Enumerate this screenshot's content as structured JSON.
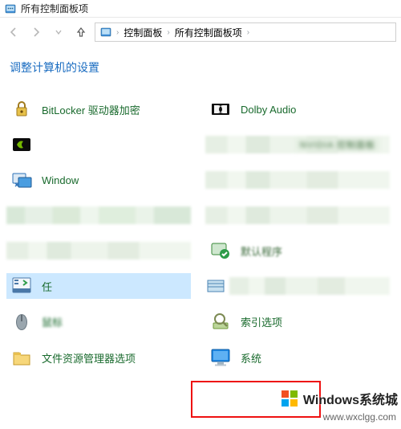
{
  "titlebar": {
    "title": "所有控制面板项"
  },
  "nav": {
    "breadcrumb": [
      "控制面板",
      "所有控制面板项"
    ]
  },
  "heading": "调整计算机的设置",
  "items": {
    "r0c0": "BitLocker 驱动器加密",
    "r0c1": "Dolby Audio",
    "r2c0": "Window",
    "r4c1_blur": "默认程序",
    "r5c0": "任",
    "r6c1": "索引选项",
    "r7c0": "文件资源管理器选项",
    "r7c1": "系统"
  },
  "blurtext": "NVIDIA 控制面板",
  "watermark": {
    "text": "Windows系统城",
    "url": "www.wxclgg.com"
  }
}
